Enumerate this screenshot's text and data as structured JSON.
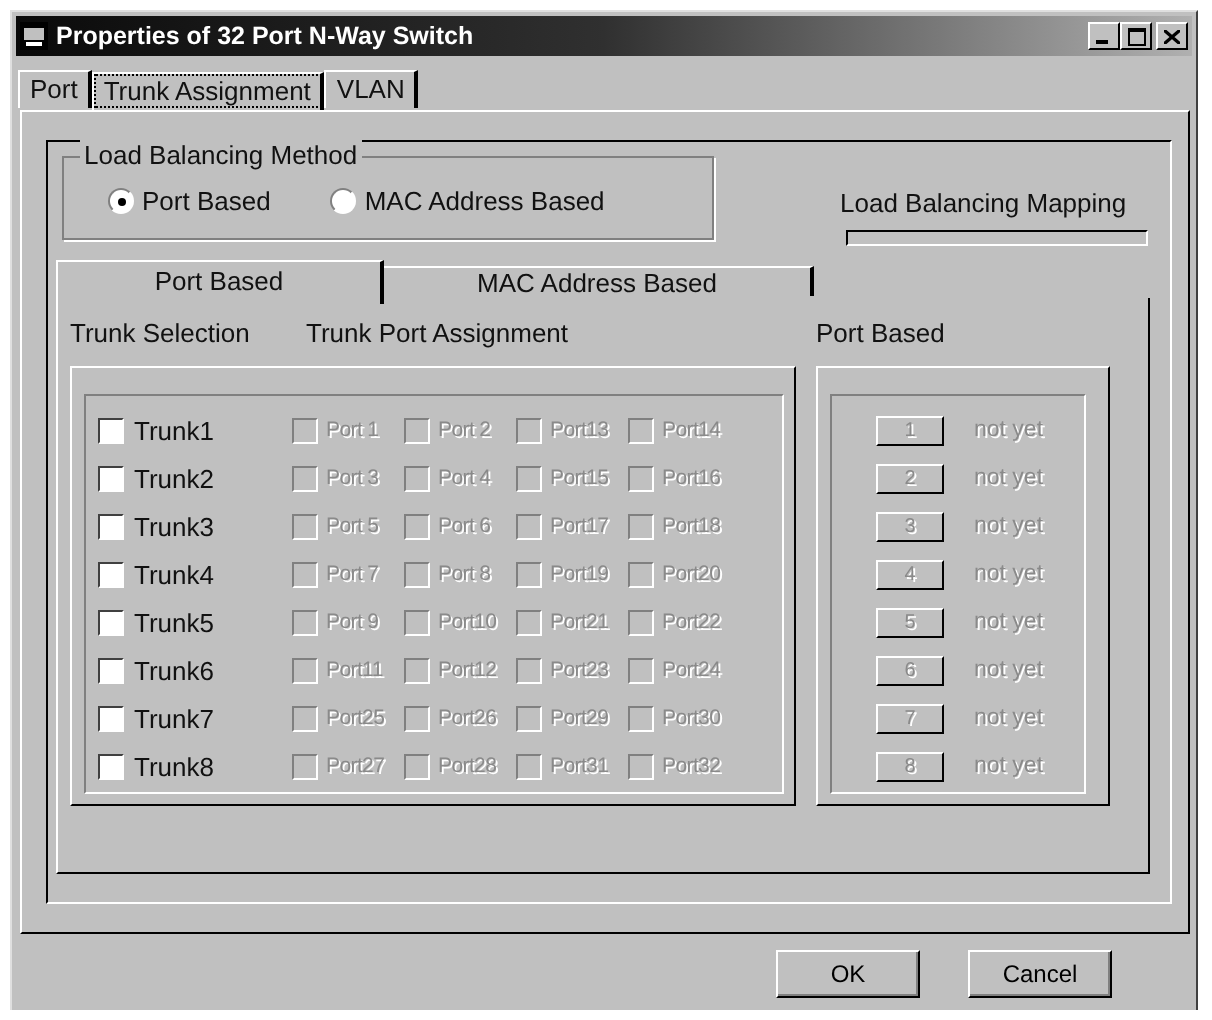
{
  "window": {
    "title": "Properties of 32 Port N-Way Switch"
  },
  "tabs": [
    {
      "label": "Port",
      "selected": false
    },
    {
      "label": "Trunk Assignment",
      "selected": true
    },
    {
      "label": "VLAN",
      "selected": false
    }
  ],
  "load_balancing_method": {
    "label": "Load Balancing Method",
    "options": [
      {
        "label": "Port Based",
        "selected": true
      },
      {
        "label": "MAC Address Based",
        "selected": false
      }
    ]
  },
  "load_balancing_mapping": {
    "label": "Load Balancing Mapping"
  },
  "inner_tabs": [
    {
      "label": "Port Based",
      "selected": true
    },
    {
      "label": "MAC Address Based",
      "selected": false
    }
  ],
  "trunk_selection_label": "Trunk Selection",
  "trunk_port_assignment_label": "Trunk Port Assignment",
  "trunks": [
    {
      "label": "Trunk1",
      "checked": false,
      "ports": [
        {
          "label": "Port 1",
          "checked": false,
          "disabled": true
        },
        {
          "label": "Port 2",
          "checked": false,
          "disabled": true
        },
        {
          "label": "Port13",
          "checked": false,
          "disabled": true
        },
        {
          "label": "Port14",
          "checked": false,
          "disabled": true
        }
      ]
    },
    {
      "label": "Trunk2",
      "checked": false,
      "ports": [
        {
          "label": "Port 3",
          "checked": false,
          "disabled": true
        },
        {
          "label": "Port 4",
          "checked": false,
          "disabled": true
        },
        {
          "label": "Port15",
          "checked": false,
          "disabled": true
        },
        {
          "label": "Port16",
          "checked": false,
          "disabled": true
        }
      ]
    },
    {
      "label": "Trunk3",
      "checked": false,
      "ports": [
        {
          "label": "Port 5",
          "checked": false,
          "disabled": true
        },
        {
          "label": "Port 6",
          "checked": false,
          "disabled": true
        },
        {
          "label": "Port17",
          "checked": false,
          "disabled": true
        },
        {
          "label": "Port18",
          "checked": false,
          "disabled": true
        }
      ]
    },
    {
      "label": "Trunk4",
      "checked": false,
      "ports": [
        {
          "label": "Port 7",
          "checked": false,
          "disabled": true
        },
        {
          "label": "Port 8",
          "checked": false,
          "disabled": true
        },
        {
          "label": "Port19",
          "checked": false,
          "disabled": true
        },
        {
          "label": "Port20",
          "checked": false,
          "disabled": true
        }
      ]
    },
    {
      "label": "Trunk5",
      "checked": false,
      "ports": [
        {
          "label": "Port 9",
          "checked": false,
          "disabled": true
        },
        {
          "label": "Port10",
          "checked": false,
          "disabled": true
        },
        {
          "label": "Port21",
          "checked": false,
          "disabled": true
        },
        {
          "label": "Port22",
          "checked": false,
          "disabled": true
        }
      ]
    },
    {
      "label": "Trunk6",
      "checked": false,
      "ports": [
        {
          "label": "Port11",
          "checked": false,
          "disabled": true
        },
        {
          "label": "Port12",
          "checked": false,
          "disabled": true
        },
        {
          "label": "Port23",
          "checked": false,
          "disabled": true
        },
        {
          "label": "Port24",
          "checked": false,
          "disabled": true
        }
      ]
    },
    {
      "label": "Trunk7",
      "checked": false,
      "ports": [
        {
          "label": "Port25",
          "checked": false,
          "disabled": true
        },
        {
          "label": "Port26",
          "checked": false,
          "disabled": true
        },
        {
          "label": "Port29",
          "checked": false,
          "disabled": true
        },
        {
          "label": "Port30",
          "checked": false,
          "disabled": true
        }
      ]
    },
    {
      "label": "Trunk8",
      "checked": false,
      "ports": [
        {
          "label": "Port27",
          "checked": false,
          "disabled": true
        },
        {
          "label": "Port28",
          "checked": false,
          "disabled": true
        },
        {
          "label": "Port31",
          "checked": false,
          "disabled": true
        },
        {
          "label": "Port32",
          "checked": false,
          "disabled": true
        }
      ]
    }
  ],
  "port_based": {
    "label": "Port Based",
    "rows": [
      {
        "button": "1",
        "status": "not yet",
        "disabled": true
      },
      {
        "button": "2",
        "status": "not yet",
        "disabled": true
      },
      {
        "button": "3",
        "status": "not yet",
        "disabled": true
      },
      {
        "button": "4",
        "status": "not yet",
        "disabled": true
      },
      {
        "button": "5",
        "status": "not yet",
        "disabled": true
      },
      {
        "button": "6",
        "status": "not yet",
        "disabled": true
      },
      {
        "button": "7",
        "status": "not yet",
        "disabled": true
      },
      {
        "button": "8",
        "status": "not yet",
        "disabled": true
      }
    ]
  },
  "buttons": [
    {
      "label": "OK"
    },
    {
      "label": "Cancel"
    }
  ]
}
